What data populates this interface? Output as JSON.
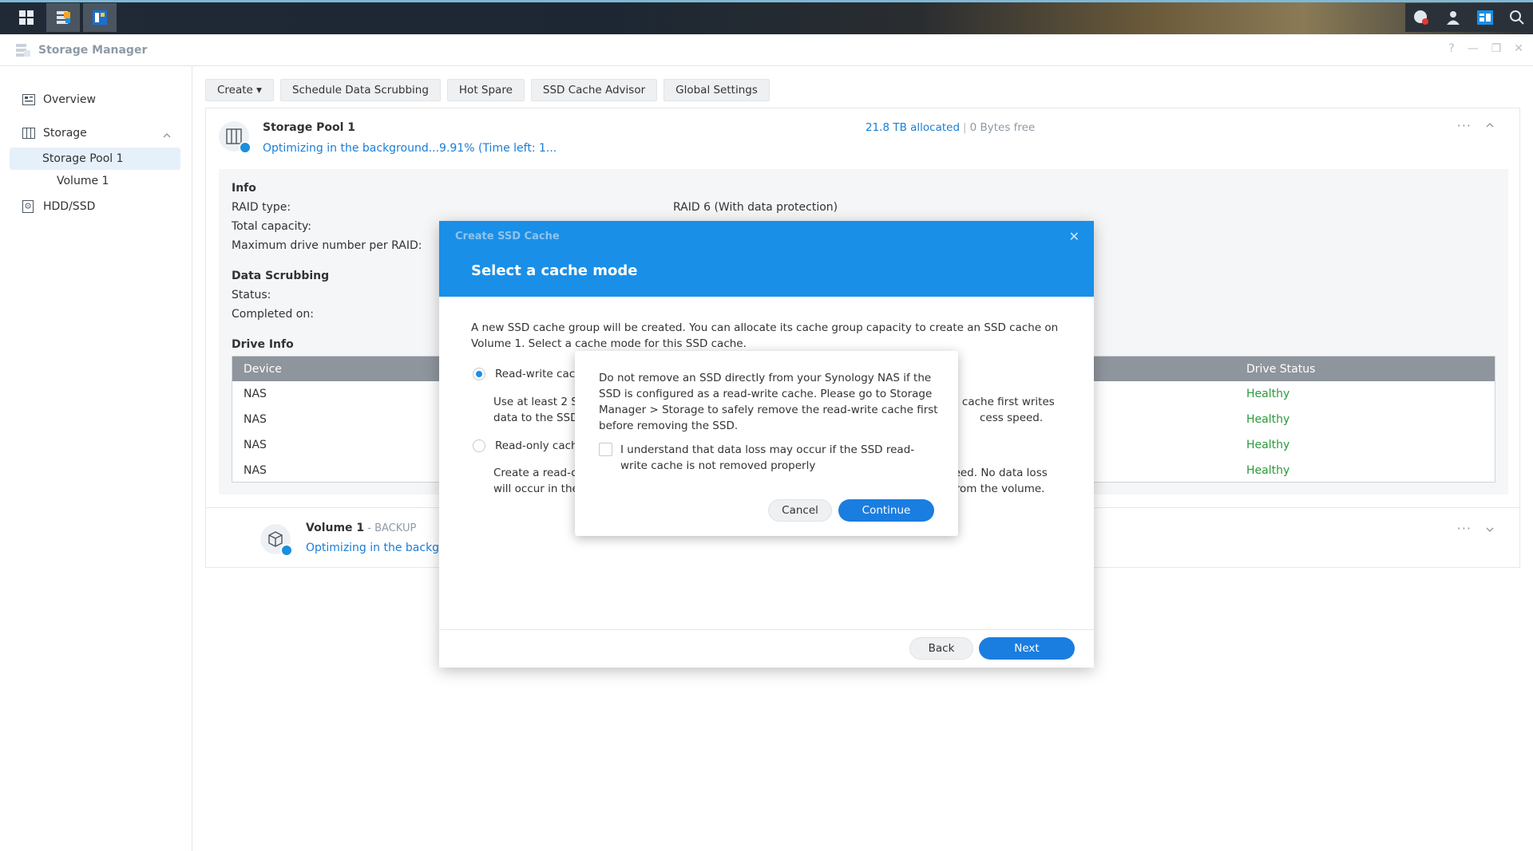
{
  "window": {
    "title": "Storage Manager",
    "help": "?",
    "minimize": "—",
    "restore": "❐",
    "close": "✕"
  },
  "sidebar": {
    "overview": "Overview",
    "storage": "Storage",
    "storage_pool": "Storage Pool 1",
    "volume": "Volume 1",
    "hdd": "HDD/SSD"
  },
  "toolbar": {
    "create": "Create ▾",
    "scrub": "Schedule Data Scrubbing",
    "hot_spare": "Hot Spare",
    "ssd_advisor": "SSD Cache Advisor",
    "global": "Global Settings"
  },
  "pool": {
    "name": "Storage Pool 1",
    "status": "Optimizing in the background...9.91% (Time left: 1...",
    "allocated": "21.8 TB allocated",
    "separator": "|",
    "free": "0 Bytes free",
    "more": "···"
  },
  "info": {
    "title": "Info",
    "raid_label": "RAID type:",
    "raid_value": "RAID 6 (With data protection)",
    "capacity_label": "Total capacity:",
    "maxdrive_label": "Maximum drive number per RAID:",
    "scrub_title": "Data Scrubbing",
    "status_label": "Status:",
    "completed_label": "Completed on:",
    "drive_title": "Drive Info"
  },
  "drive_table": {
    "col_device": "Device",
    "col_status": "Drive Status",
    "rows": [
      {
        "device": "NAS",
        "status": "Healthy"
      },
      {
        "device": "NAS",
        "status": "Healthy"
      },
      {
        "device": "NAS",
        "status": "Healthy"
      },
      {
        "device": "NAS",
        "status": "Healthy"
      }
    ]
  },
  "volume": {
    "name": "Volume 1",
    "sub": " - BACKUP",
    "status": "Optimizing in the backgro",
    "more": "···"
  },
  "dialog": {
    "small_title": "Create SSD Cache",
    "close": "✕",
    "title": "Select a cache mode",
    "intro_1": "A new SSD cache group will be created. You can allocate its cache group capacity to create an SSD cache on",
    "intro_2": "Volume 1. Select a cache mode for this SSD cache.",
    "rw_label": "Read-write cach",
    "rw_desc_l1": "Use at least 2 S",
    "rw_desc_l2": "data to the SSD",
    "rw_desc_r1": "te cache first writes",
    "rw_desc_r2": "cess speed.",
    "ro_label": "Read-only cach",
    "ro_desc_l1": "Create a read-o",
    "ro_desc_l2": "will occur in the",
    "ro_desc_r1": "peed. No data loss",
    "ro_desc_r2": "from the volume.",
    "back": "Back",
    "next": "Next"
  },
  "popup": {
    "text": "Do not remove an SSD directly from your Synology NAS if the SSD is configured as a read-write cache. Please go to Storage Manager > Storage to safely remove the read-write cache first before removing the SSD.",
    "checkbox_label": "I understand that data loss may occur if the SSD read-write cache is not removed properly",
    "cancel": "Cancel",
    "continue": "Continue"
  },
  "colors": {
    "accent": "#1a8fe8",
    "healthy": "#2b9a3b",
    "link": "#1a7dd6"
  }
}
